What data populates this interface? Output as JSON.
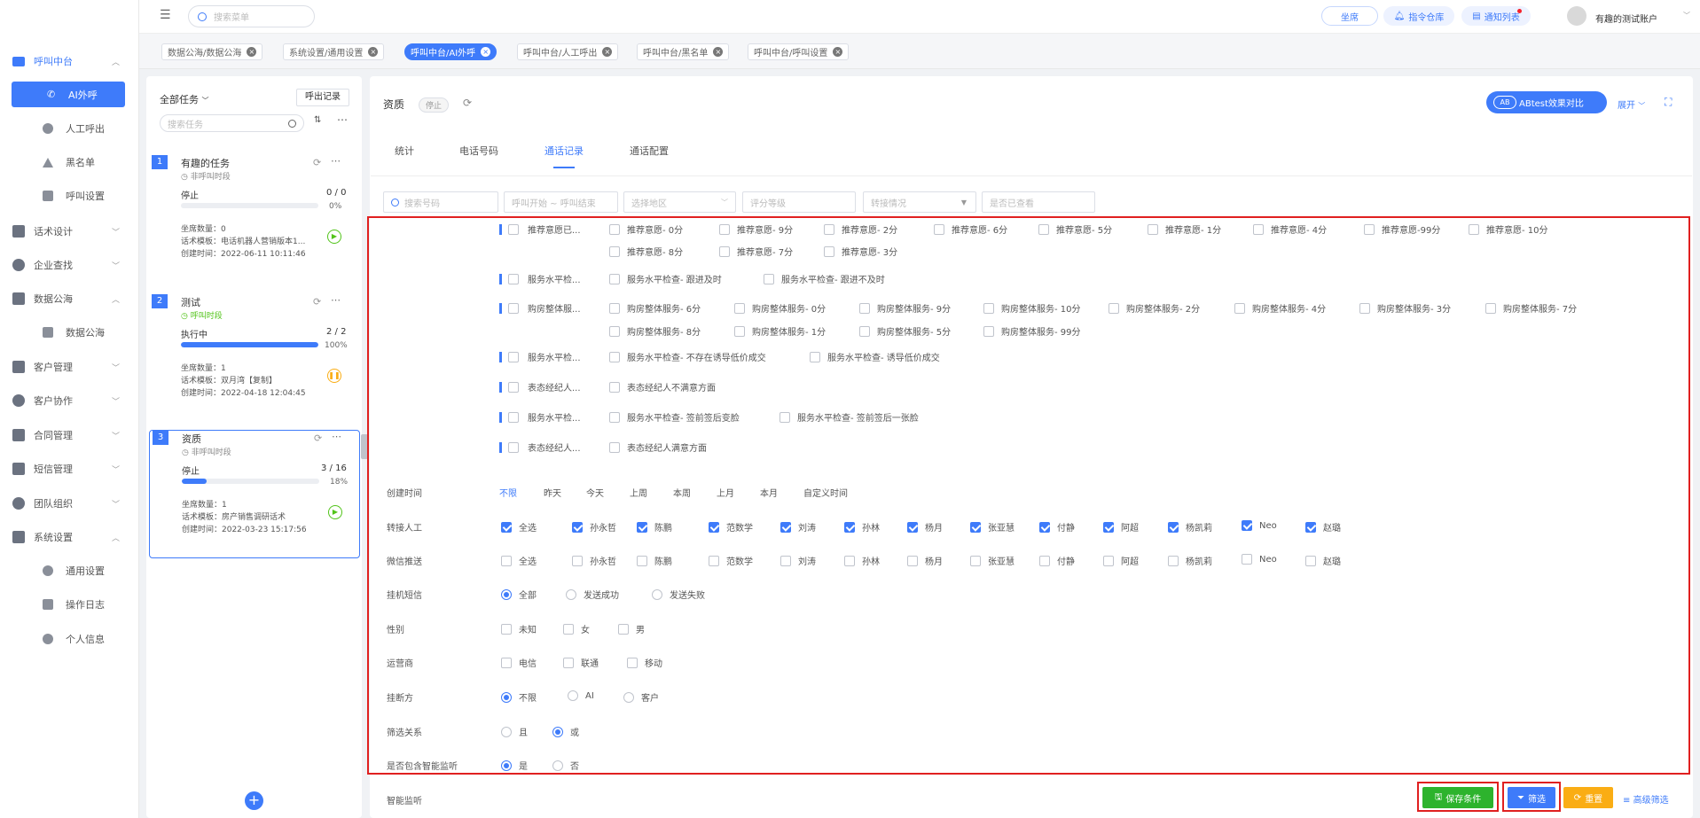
{
  "topbar": {
    "search_placeholder": "搜索菜单",
    "btn_seat": "坐席",
    "btn_command": "指令仓库",
    "btn_notice": "通知列表",
    "user": "有趣的测试账户"
  },
  "tags": [
    {
      "label": "数据公海/数据公海"
    },
    {
      "label": "系统设置/通用设置"
    },
    {
      "label": "呼叫中台/AI外呼",
      "active": true
    },
    {
      "label": "呼叫中台/人工呼出"
    },
    {
      "label": "呼叫中台/黑名单"
    },
    {
      "label": "呼叫中台/呼叫设置"
    }
  ],
  "sidebar": {
    "call_center": "呼叫中台",
    "ai_call": "AI外呼",
    "manual": "人工呼出",
    "blacklist": "黑名单",
    "call_settings": "呼叫设置",
    "script": "话术设计",
    "enterprise": "企业查找",
    "data_sea": "数据公海",
    "data_sea_sub": "数据公海",
    "customer": "客户管理",
    "collab": "客户协作",
    "contract": "合同管理",
    "sms": "短信管理",
    "team": "团队组织",
    "system": "系统设置",
    "general": "通用设置",
    "oplog": "操作日志",
    "personal": "个人信息"
  },
  "taskpanel": {
    "filter": "全部任务",
    "records": "呼出记录",
    "search_placeholder": "搜索任务"
  },
  "tasks": [
    {
      "num": "1",
      "name": "有趣的任务",
      "time": "非呼叫时段",
      "status": "停止",
      "count": "0 / 0",
      "progress": 0,
      "pct": "0%",
      "seats": "坐席数量：0",
      "script": "话术模板：电话机器人营销版本1...",
      "created": "创建时间：2022-06-11 10:11:46"
    },
    {
      "num": "2",
      "name": "测试",
      "time": "呼叫时段",
      "status": "执行中",
      "count": "2 / 2",
      "progress": 100,
      "pct": "100%",
      "seats": "坐席数量：1",
      "script": "话术模板：双月湾【复制】",
      "created": "创建时间：2022-04-18 12:04:45"
    },
    {
      "num": "3",
      "name": "资质",
      "time": "非呼叫时段",
      "status": "停止",
      "count": "3 / 16",
      "progress": 18,
      "pct": "18%",
      "seats": "坐席数量：1",
      "script": "话术模板：房产销售调研话术",
      "created": "创建时间：2022-03-23 15:17:56"
    }
  ],
  "header": {
    "title": "资质",
    "status": "停止",
    "abtest": "ABtest效果对比",
    "expand": "展开"
  },
  "tabs": [
    "统计",
    "电话号码",
    "通话记录",
    "通话配置"
  ],
  "filters": {
    "phone": "搜索号码",
    "range": "呼叫开始 ~ 呼叫结束",
    "region": "选择地区",
    "score": "评分等级",
    "transfer": "转接情况",
    "viewed": "是否已查看"
  },
  "groups": [
    {
      "label": "推荐意愿已...",
      "rows": [
        [
          "推荐意愿- 0分",
          "推荐意愿- 9分",
          "推荐意愿- 2分",
          "推荐意愿- 6分",
          "推荐意愿- 5分",
          "推荐意愿- 1分",
          "推荐意愿- 4分",
          "推荐意愿-99分",
          "推荐意愿- 10分"
        ],
        [
          "推荐意愿- 8分",
          "推荐意愿- 7分",
          "推荐意愿- 3分"
        ]
      ]
    },
    {
      "label": "服务水平检...",
      "rows": [
        [
          "服务水平检查- 跟进及时",
          "服务水平检查- 跟进不及时"
        ]
      ]
    },
    {
      "label": "购房整体服...",
      "rows": [
        [
          "购房整体服务- 6分",
          "购房整体服务- 0分",
          "购房整体服务- 9分",
          "购房整体服务- 10分",
          "购房整体服务- 2分",
          "购房整体服务- 4分",
          "购房整体服务- 3分",
          "购房整体服务- 7分"
        ],
        [
          "购房整体服务- 8分",
          "购房整体服务- 1分",
          "购房整体服务- 5分",
          "购房整体服务- 99分"
        ]
      ]
    },
    {
      "label": "服务水平检...",
      "rows": [
        [
          "服务水平检查- 不存在诱导低价成交",
          "服务水平检查- 诱导低价成交"
        ]
      ]
    },
    {
      "label": "表态经纪人...",
      "rows": [
        [
          "表态经纪人不满意方面"
        ]
      ]
    },
    {
      "label": "服务水平检...",
      "rows": [
        [
          "服务水平检查- 签前签后变脸",
          "服务水平检查- 签前签后一张脸"
        ]
      ]
    },
    {
      "label": "表态经纪人...",
      "rows": [
        [
          "表态经纪人满意方面"
        ]
      ]
    }
  ],
  "labels": {
    "created": "创建时间",
    "transfer": "转接人工",
    "wechat": "微信推送",
    "sms": "挂机短信",
    "gender": "性别",
    "carrier": "运营商",
    "hangup": "挂断方",
    "relation": "筛选关系",
    "monitor": "是否包含智能监听",
    "smart": "智能监听"
  },
  "time_opts": [
    "不限",
    "昨天",
    "今天",
    "上周",
    "本周",
    "上月",
    "本月",
    "自定义时间"
  ],
  "people": [
    "全选",
    "孙永哲",
    "陈鹏",
    "范数学",
    "刘涛",
    "孙林",
    "杨月",
    "张亚慧",
    "付静",
    "阿超",
    "杨凯莉",
    "Neo",
    "赵璐"
  ],
  "sms_opts": [
    "全部",
    "发送成功",
    "发送失败"
  ],
  "gender_opts": [
    "未知",
    "女",
    "男"
  ],
  "carrier_opts": [
    "电信",
    "联通",
    "移动"
  ],
  "hangup_opts": [
    "不限",
    "AI",
    "客户"
  ],
  "relation_opts": [
    "且",
    "或"
  ],
  "monitor_opts": [
    "是",
    "否"
  ],
  "buttons": {
    "save": "保存条件",
    "filter": "筛选",
    "reset": "重置",
    "advanced": "高级筛选"
  }
}
